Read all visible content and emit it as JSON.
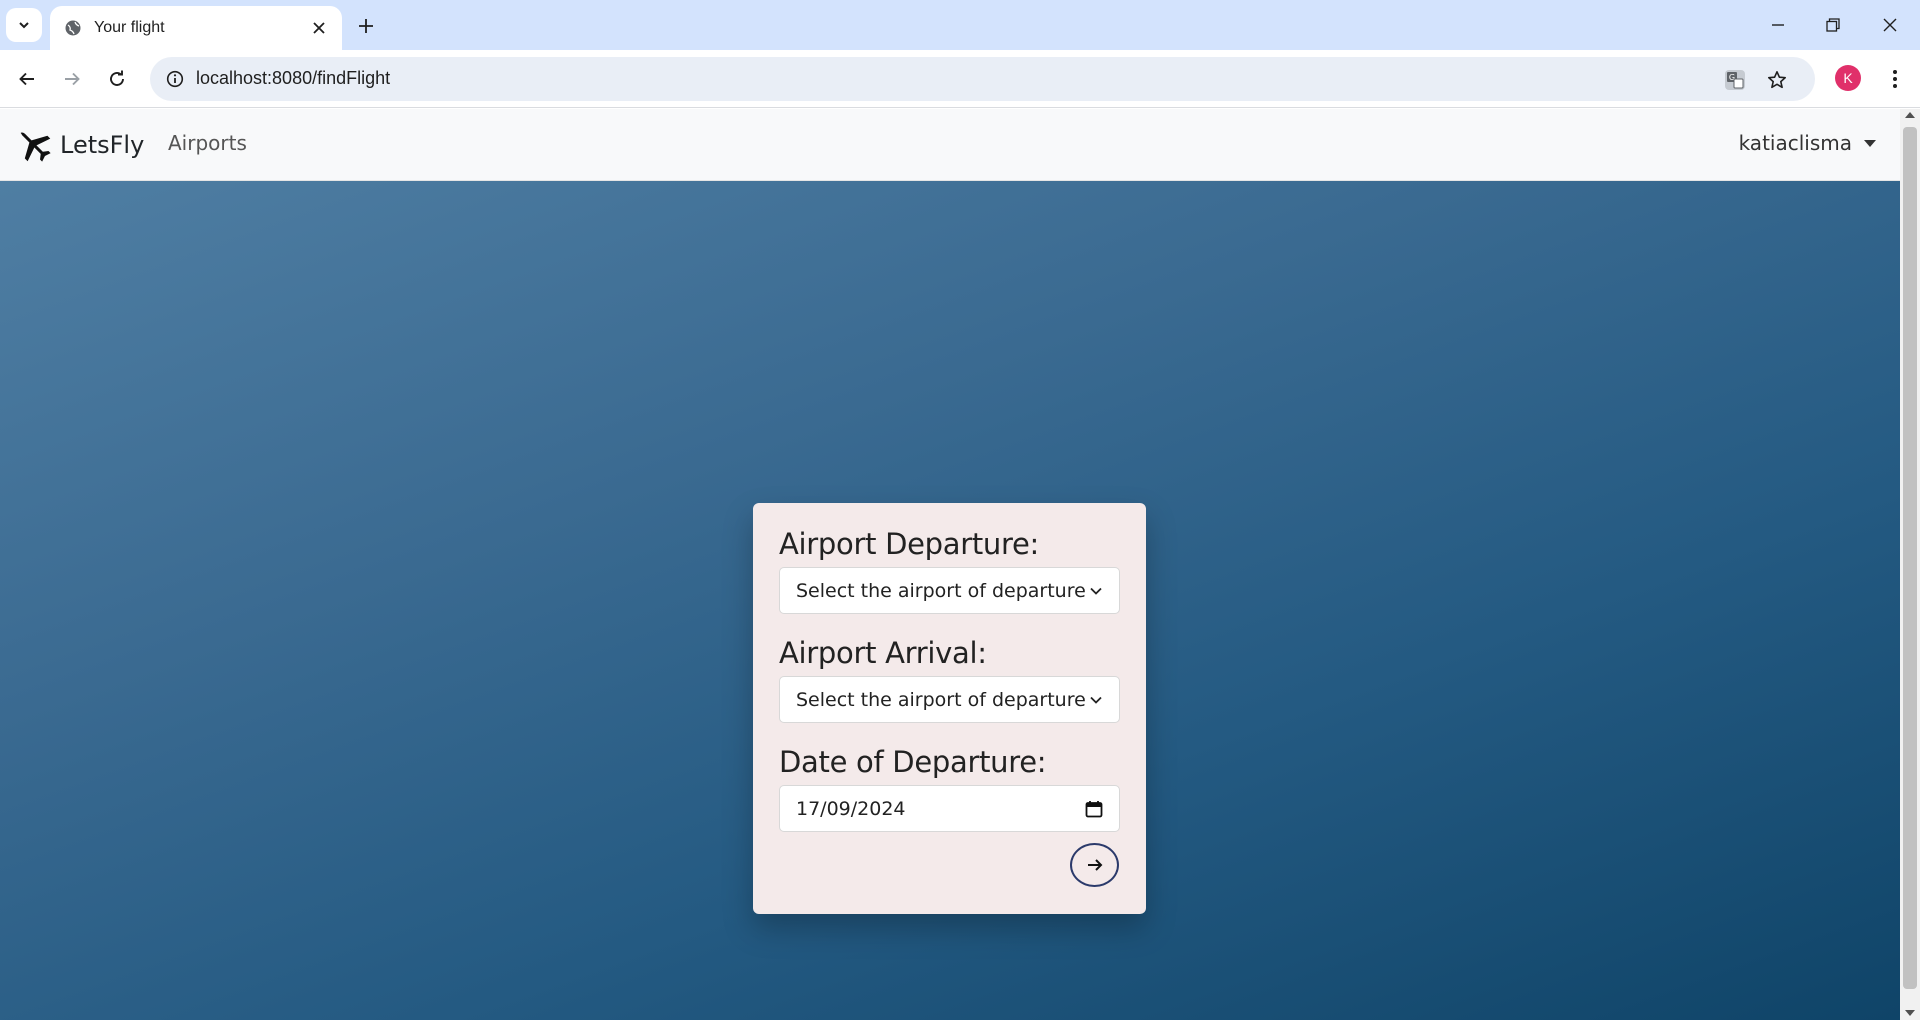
{
  "browser": {
    "tab_title": "Your flight",
    "url": "localhost:8080/findFlight",
    "profile_initial": "K",
    "profile_color": "#e0306a",
    "icons": [
      "tab-search-icon",
      "globe-icon",
      "close-icon",
      "plus-icon",
      "minimize-icon",
      "restore-icon",
      "window-close-icon",
      "back-arrow-icon",
      "forward-arrow-icon",
      "reload-icon",
      "info-icon",
      "translate-icon",
      "star-icon",
      "more-vert-icon"
    ]
  },
  "navbar": {
    "brand": "LetsFly",
    "brand_icon": "airplane-icon",
    "link_airports": "Airports",
    "username": "katiaclisma"
  },
  "form": {
    "departure_label": "Airport Departure:",
    "departure_placeholder": "Select the airport of departure",
    "arrival_label": "Airport Arrival:",
    "arrival_placeholder": "Select the airport of departure",
    "date_label": "Date of Departure:",
    "date_value": "17/09/2024",
    "submit_icon": "arrow-right-icon"
  },
  "colors": {
    "tabbar_bg": "#d3e3fd",
    "hero_gradient_start": "#4f7ea3",
    "hero_gradient_end": "#0f4468",
    "card_bg": "#f4eaea",
    "submit_border": "#2b3a6b"
  }
}
